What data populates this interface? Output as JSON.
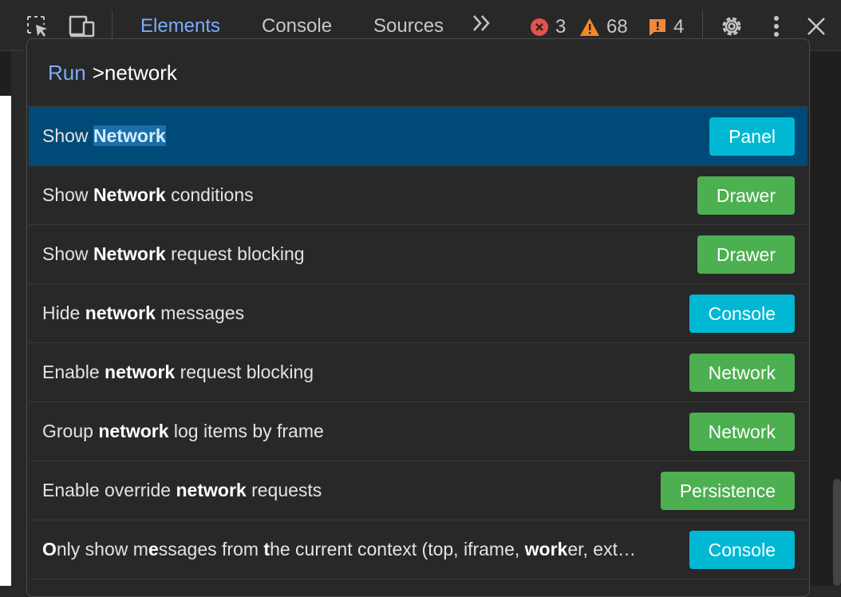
{
  "toolbar": {
    "tabs": [
      "Elements",
      "Console",
      "Sources"
    ],
    "more_tabs_glyph": "»",
    "errors": "3",
    "warnings": "68",
    "issues": "4",
    "icons": [
      "inspect-element-icon",
      "device-toggle-icon",
      "gear-icon",
      "more-vert-icon",
      "close-icon"
    ],
    "colors": {
      "active_tab": "#7cacf8",
      "error": "#e5534b",
      "warning": "#f28b24",
      "issue": "#f0883e"
    }
  },
  "palette": {
    "prefix": "Run",
    "query": ">network",
    "items": [
      {
        "before": "Show ",
        "match": "Network",
        "after": "",
        "badge": "Panel",
        "badge_color": "cyan",
        "selected": true
      },
      {
        "before": "Show ",
        "match": "Network",
        "after": " conditions",
        "badge": "Drawer",
        "badge_color": "green"
      },
      {
        "before": "Show ",
        "match": "Network",
        "after": " request blocking",
        "badge": "Drawer",
        "badge_color": "green"
      },
      {
        "before": "Hide ",
        "match": "network",
        "after": " messages",
        "badge": "Console",
        "badge_color": "cyan"
      },
      {
        "before": "Enable ",
        "match": "network",
        "after": " request blocking",
        "badge": "Network",
        "badge_color": "green"
      },
      {
        "before": "Group ",
        "match": "network",
        "after": " log items by frame",
        "badge": "Network",
        "badge_color": "green"
      },
      {
        "before": "Enable override ",
        "match": "network",
        "after": " requests",
        "badge": "Persistence",
        "badge_color": "green"
      },
      {
        "rich": [
          [
            "O",
            true
          ],
          [
            "nly show m",
            false
          ],
          [
            "e",
            true
          ],
          [
            "ssages from ",
            false
          ],
          [
            "t",
            true
          ],
          [
            "he current context (top, iframe, ",
            false
          ],
          [
            "work",
            true
          ],
          [
            "er, ext…",
            false
          ]
        ],
        "badge": "Console",
        "badge_color": "cyan"
      }
    ]
  }
}
